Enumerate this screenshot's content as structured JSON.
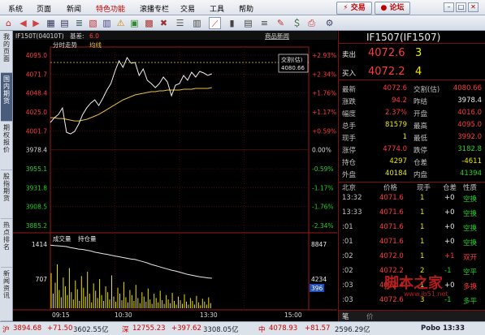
{
  "menu": {
    "items": [
      "系统",
      "页面",
      "新闻",
      "特色功能",
      "滚播专栏",
      "交易",
      "工具",
      "帮助"
    ],
    "trade_btn": "⚡ 交易",
    "forum_btn": "● 论坛"
  },
  "vtabs": [
    "我的页面",
    "国内期货",
    "期权报价",
    "股指期货",
    "热点排名",
    "新闻资讯"
  ],
  "header": {
    "symbol": "IF150T(04010T)",
    "basis_label": "基差:",
    "basis_value": "6.0",
    "news_link": "商品新闻"
  },
  "intraday": {
    "label": "分时走势",
    "line_label": "均线",
    "price_ticks": [
      "4095.0",
      "4071.7",
      "4048.4",
      "4025.0",
      "4001.7",
      "3978.4",
      "3955.1",
      "3931.8",
      "3908.5",
      "3885.2"
    ],
    "pct_ticks": [
      "+2.93%",
      "+2.34%",
      "+1.76%",
      "+1.17%",
      "+0.59%",
      "0.00%",
      "-0.59%",
      "-1.17%",
      "-1.76%",
      "-2.34%"
    ],
    "tip_label": "交割(估)",
    "tip_value": "4080.66"
  },
  "volume": {
    "label1": "成交量",
    "label2": "持仓量",
    "left_ticks": [
      "1414",
      "707"
    ],
    "right_ticks": [
      "8847",
      "4234",
      "396"
    ]
  },
  "time_axis": [
    "09:15",
    "10:30",
    "13:30",
    "15:00"
  ],
  "quote": {
    "title": "IF1507(IF1507)",
    "sell": {
      "label": "卖出",
      "price": "4072.6",
      "qty": "3"
    },
    "buy": {
      "label": "买入",
      "price": "4072.2",
      "qty": "4"
    },
    "rows": [
      [
        "最新",
        "4072.6",
        "交割(估)",
        "4080.66"
      ],
      [
        "涨跌",
        "94.2",
        "昨结",
        "3978.4"
      ],
      [
        "幅度",
        "2.37%",
        "开盘",
        "4016.0"
      ],
      [
        "总手",
        "81579",
        "最高",
        "4095.0"
      ],
      [
        "现手",
        "1",
        "最低",
        "3992.0"
      ],
      [
        "涨停",
        "4774.0",
        "跌停",
        "3182.8"
      ],
      [
        "持仓",
        "4297",
        "仓差",
        "-4611"
      ],
      [
        "外盘",
        "40184",
        "内盘",
        "41394"
      ]
    ],
    "tick_header": [
      "北京",
      "价格",
      "现手",
      "仓差",
      "性质"
    ],
    "ticks": [
      [
        "13:32",
        "4071.6",
        "1",
        "+0",
        "空换"
      ],
      [
        "13:33",
        "4071.6",
        "1",
        "+0",
        "空换"
      ],
      [
        ":01",
        "4071.6",
        "1",
        "+0",
        "空换"
      ],
      [
        ":01",
        "4071.6",
        "1",
        "+0",
        "空换"
      ],
      [
        ":02",
        "4072.0",
        "1",
        "+1",
        "双开"
      ],
      [
        ":02",
        "4072.2",
        "2",
        "-1",
        "空平"
      ],
      [
        ":03",
        "4072.4",
        "1",
        "+0",
        "多换"
      ],
      [
        ":03",
        "4072.6",
        "3",
        "-1",
        "多平"
      ]
    ],
    "bottom_tabs": [
      "笔",
      "价"
    ]
  },
  "statusbar": {
    "items": [
      [
        "沪",
        "3894.68",
        "+71.50",
        "3602.55亿"
      ],
      [
        "深",
        "12755.23",
        "+397.62",
        "3308.05亿"
      ],
      [
        "中",
        "4078.93",
        "+81.57",
        "2596.29亿"
      ]
    ],
    "right": "Pobo 13:33"
  },
  "watermark": "脚本之家",
  "watermark_url": "www.jb51.net",
  "chart_data": {
    "type": "line",
    "x_range": [
      "09:15",
      "15:00"
    ],
    "ylim": [
      3885.2,
      4095.0
    ],
    "prev_settle": 3978.4,
    "price": [
      4012,
      4018,
      4022,
      4030,
      4000,
      3998,
      4001,
      4010,
      4022,
      4030,
      4036,
      4040,
      4033,
      4042,
      4052,
      4060,
      4075,
      4088,
      4080,
      4092,
      4085,
      4086,
      4070,
      4078,
      4064,
      4060,
      4055,
      4060,
      4068,
      4062,
      4045,
      4058,
      4060,
      4070,
      4064,
      4074,
      4068,
      4075,
      4073,
      4070,
      4072
    ],
    "avg": [
      4018,
      4018,
      4017,
      4017,
      4016,
      4015,
      4014,
      4014,
      4015,
      4016,
      4018,
      4020,
      4022,
      4025,
      4028,
      4031,
      4034,
      4037,
      4040,
      4042,
      4044,
      4046,
      4047,
      4048,
      4049,
      4050,
      4050,
      4051,
      4051,
      4052,
      4052,
      4052,
      4052,
      4053,
      4053,
      4053,
      4054,
      4054,
      4054,
      4054,
      4055
    ],
    "oi": [
      8600,
      8550,
      8520,
      8480,
      8420,
      8300,
      8200,
      8100,
      8050,
      7950,
      7850,
      7700,
      7600,
      7500,
      7420,
      7300,
      7200,
      7100,
      7000,
      6900,
      6800,
      6750,
      6600,
      6450,
      6300,
      6100,
      5950,
      5800,
      5650,
      5500,
      5350,
      5250,
      5100,
      4950,
      4800,
      4700,
      4600,
      4500,
      4420,
      4350,
      4300
    ]
  }
}
